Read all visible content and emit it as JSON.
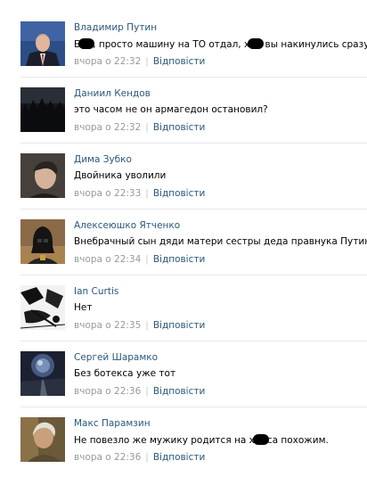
{
  "meta_separator": "|",
  "comments": [
    {
      "author": "Владимир Путин",
      "text_parts": [
        "Б",
        ", просто машину на ТО отдал, х",
        " вы накинулись сразу"
      ],
      "time": "вчора о 22:32",
      "reply": "Відповісти",
      "avatar_icon": "portrait-man-suit-icon"
    },
    {
      "author": "Даниил Кендов",
      "text_parts": [
        "это часом не он армагедон остановил?"
      ],
      "time": "вчора о 22:32",
      "reply": "Відповісти",
      "avatar_icon": "dark-forest-icon"
    },
    {
      "author": "Дима Зубко",
      "text_parts": [
        "Двойника уволили"
      ],
      "time": "вчора о 22:33",
      "reply": "Відповісти",
      "avatar_icon": "portrait-young-man-icon"
    },
    {
      "author": "Алексеюшко Ятченко",
      "text_parts": [
        "Внебрачный сын дяди матери сестры деда правнука Путина"
      ],
      "time": "вчора о 22:34",
      "reply": "Відповісти",
      "avatar_icon": "darth-vader-icon"
    },
    {
      "author": "Ian Curtis",
      "text_parts": [
        "Нет"
      ],
      "time": "вчора о 22:35",
      "reply": "Відповісти",
      "avatar_icon": "ink-drawing-icon"
    },
    {
      "author": "Сергей Шарамко",
      "text_parts": [
        "Без ботекса уже тот"
      ],
      "time": "вчора о 22:36",
      "reply": "Відповісти",
      "avatar_icon": "cosmic-road-icon"
    },
    {
      "author": "Макс Парамзин",
      "text_parts": [
        "Не повезло же мужику родится на х",
        "са похожим."
      ],
      "time": "вчора о 22:36",
      "reply": "Відповісти",
      "avatar_icon": "portrait-old-man-icon"
    }
  ]
}
